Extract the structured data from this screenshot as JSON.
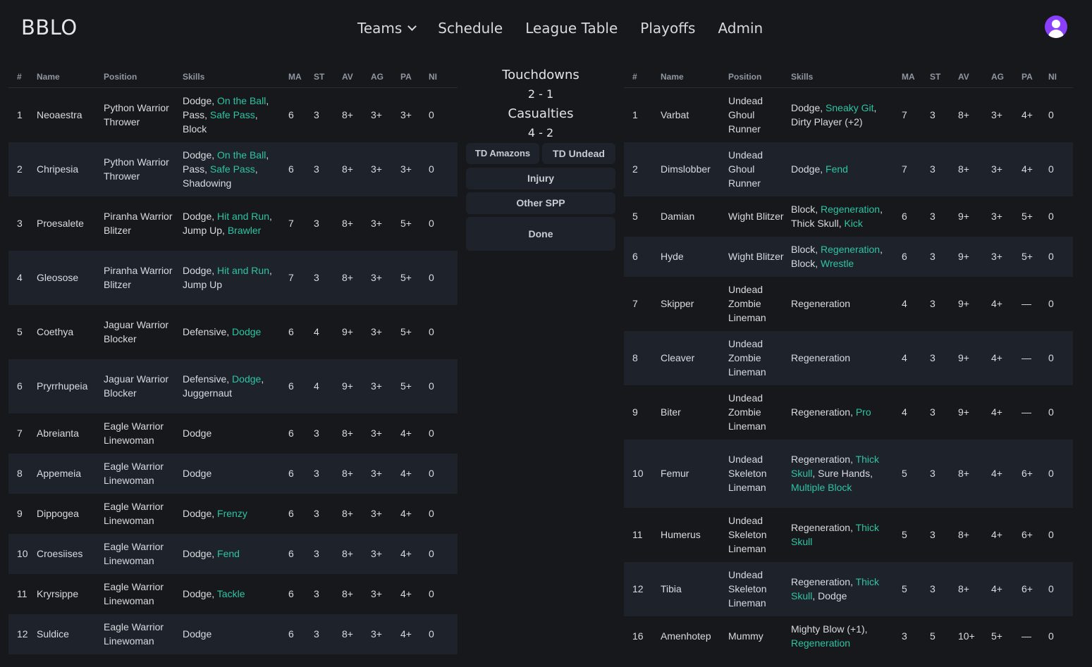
{
  "brand": "BBLO",
  "nav": {
    "teams": "Teams",
    "schedule": "Schedule",
    "league_table": "League Table",
    "playoffs": "Playoffs",
    "admin": "Admin"
  },
  "columns": [
    "#",
    "Name",
    "Position",
    "Skills",
    "MA",
    "ST",
    "AV",
    "AG",
    "PA",
    "NI"
  ],
  "match": {
    "touchdowns_label": "Touchdowns",
    "touchdowns_score": "2 - 1",
    "casualties_label": "Casualties",
    "casualties_score": "4 - 2",
    "buttons": {
      "td_home": "TD Amazons",
      "td_away": "TD Undead",
      "injury": "Injury",
      "other_spp": "Other SPP",
      "done": "Done"
    }
  },
  "home_players": [
    {
      "num": "1",
      "name": "Neoaestra",
      "position": "Python Warrior Thrower",
      "skills": [
        {
          "t": "Dodge",
          "g": false
        },
        {
          "t": "On the Ball",
          "g": true
        },
        {
          "t": "Pass",
          "g": false
        },
        {
          "t": "Safe Pass",
          "g": true
        },
        {
          "t": "Block",
          "g": false
        }
      ],
      "ma": "6",
      "st": "3",
      "av": "8+",
      "ag": "3+",
      "pa": "3+",
      "ni": "0"
    },
    {
      "num": "2",
      "name": "Chripesia",
      "position": "Python Warrior Thrower",
      "skills": [
        {
          "t": "Dodge",
          "g": false
        },
        {
          "t": "On the Ball",
          "g": true
        },
        {
          "t": "Pass",
          "g": false
        },
        {
          "t": "Safe Pass",
          "g": true
        },
        {
          "t": "Shadowing",
          "g": false
        }
      ],
      "ma": "6",
      "st": "3",
      "av": "8+",
      "ag": "3+",
      "pa": "3+",
      "ni": "0"
    },
    {
      "num": "3",
      "name": "Proesalete",
      "position": "Piranha Warrior Blitzer",
      "skills": [
        {
          "t": "Dodge",
          "g": false
        },
        {
          "t": "Hit and Run",
          "g": true
        },
        {
          "t": "Jump Up",
          "g": false
        },
        {
          "t": "Brawler",
          "g": true
        }
      ],
      "ma": "7",
      "st": "3",
      "av": "8+",
      "ag": "3+",
      "pa": "5+",
      "ni": "0"
    },
    {
      "num": "4",
      "name": "Gleosose",
      "position": "Piranha Warrior Blitzer",
      "skills": [
        {
          "t": "Dodge",
          "g": false
        },
        {
          "t": "Hit and Run",
          "g": true
        },
        {
          "t": "Jump Up",
          "g": false
        }
      ],
      "ma": "7",
      "st": "3",
      "av": "8+",
      "ag": "3+",
      "pa": "5+",
      "ni": "0"
    },
    {
      "num": "5",
      "name": "Coethya",
      "position": "Jaguar Warrior Blocker",
      "skills": [
        {
          "t": "Defensive",
          "g": false
        },
        {
          "t": "Dodge",
          "g": true
        }
      ],
      "ma": "6",
      "st": "4",
      "av": "9+",
      "ag": "3+",
      "pa": "5+",
      "ni": "0"
    },
    {
      "num": "6",
      "name": "Pryrrhupeia",
      "position": "Jaguar Warrior Blocker",
      "skills": [
        {
          "t": "Defensive",
          "g": false
        },
        {
          "t": "Dodge",
          "g": true
        },
        {
          "t": "Juggernaut",
          "g": false
        }
      ],
      "ma": "6",
      "st": "4",
      "av": "9+",
      "ag": "3+",
      "pa": "5+",
      "ni": "0"
    },
    {
      "num": "7",
      "name": "Abreianta",
      "position": "Eagle Warrior Linewoman",
      "skills": [
        {
          "t": "Dodge",
          "g": false
        }
      ],
      "ma": "6",
      "st": "3",
      "av": "8+",
      "ag": "3+",
      "pa": "4+",
      "ni": "0"
    },
    {
      "num": "8",
      "name": "Appemeia",
      "position": "Eagle Warrior Linewoman",
      "skills": [
        {
          "t": "Dodge",
          "g": false
        }
      ],
      "ma": "6",
      "st": "3",
      "av": "8+",
      "ag": "3+",
      "pa": "4+",
      "ni": "0"
    },
    {
      "num": "9",
      "name": "Dippogea",
      "position": "Eagle Warrior Linewoman",
      "skills": [
        {
          "t": "Dodge",
          "g": false
        },
        {
          "t": "Frenzy",
          "g": true
        }
      ],
      "ma": "6",
      "st": "3",
      "av": "8+",
      "ag": "3+",
      "pa": "4+",
      "ni": "0"
    },
    {
      "num": "10",
      "name": "Croesiises",
      "position": "Eagle Warrior Linewoman",
      "skills": [
        {
          "t": "Dodge",
          "g": false
        },
        {
          "t": "Fend",
          "g": true
        }
      ],
      "ma": "6",
      "st": "3",
      "av": "8+",
      "ag": "3+",
      "pa": "4+",
      "ni": "0"
    },
    {
      "num": "11",
      "name": "Kryrsippe",
      "position": "Eagle Warrior Linewoman",
      "skills": [
        {
          "t": "Dodge",
          "g": false
        },
        {
          "t": "Tackle",
          "g": true
        }
      ],
      "ma": "6",
      "st": "3",
      "av": "8+",
      "ag": "3+",
      "pa": "4+",
      "ni": "0"
    },
    {
      "num": "12",
      "name": "Suldice",
      "position": "Eagle Warrior Linewoman",
      "skills": [
        {
          "t": "Dodge",
          "g": false
        }
      ],
      "ma": "6",
      "st": "3",
      "av": "8+",
      "ag": "3+",
      "pa": "4+",
      "ni": "0"
    }
  ],
  "away_players": [
    {
      "num": "1",
      "name": "Varbat",
      "position": "Undead Ghoul Runner",
      "skills": [
        {
          "t": "Dodge",
          "g": false
        },
        {
          "t": "Sneaky Git",
          "g": true
        },
        {
          "t": "Dirty Player (+2)",
          "g": false
        }
      ],
      "ma": "7",
      "st": "3",
      "av": "8+",
      "ag": "3+",
      "pa": "4+",
      "ni": "0"
    },
    {
      "num": "2",
      "name": "Dimslobber",
      "position": "Undead Ghoul Runner",
      "skills": [
        {
          "t": "Dodge",
          "g": false
        },
        {
          "t": "Fend",
          "g": true
        }
      ],
      "ma": "7",
      "st": "3",
      "av": "8+",
      "ag": "3+",
      "pa": "4+",
      "ni": "0"
    },
    {
      "num": "5",
      "name": "Damian",
      "position": "Wight Blitzer",
      "skills": [
        {
          "t": "Block",
          "g": false
        },
        {
          "t": "Regeneration",
          "g": true
        },
        {
          "t": "Thick Skull",
          "g": false
        },
        {
          "t": "Kick",
          "g": true
        }
      ],
      "ma": "6",
      "st": "3",
      "av": "9+",
      "ag": "3+",
      "pa": "5+",
      "ni": "0"
    },
    {
      "num": "6",
      "name": "Hyde",
      "position": "Wight Blitzer",
      "skills": [
        {
          "t": "Block",
          "g": false
        },
        {
          "t": "Regeneration",
          "g": true
        },
        {
          "t": "Block",
          "g": false
        },
        {
          "t": "Wrestle",
          "g": true
        }
      ],
      "ma": "6",
      "st": "3",
      "av": "9+",
      "ag": "3+",
      "pa": "5+",
      "ni": "0"
    },
    {
      "num": "7",
      "name": "Skipper",
      "position": "Undead Zombie Lineman",
      "skills": [
        {
          "t": "Regeneration",
          "g": false
        }
      ],
      "ma": "4",
      "st": "3",
      "av": "9+",
      "ag": "4+",
      "pa": "—",
      "ni": "0"
    },
    {
      "num": "8",
      "name": "Cleaver",
      "position": "Undead Zombie Lineman",
      "skills": [
        {
          "t": "Regeneration",
          "g": false
        }
      ],
      "ma": "4",
      "st": "3",
      "av": "9+",
      "ag": "4+",
      "pa": "—",
      "ni": "0"
    },
    {
      "num": "9",
      "name": "Biter",
      "position": "Undead Zombie Lineman",
      "skills": [
        {
          "t": "Regeneration",
          "g": false
        },
        {
          "t": "Pro",
          "g": true
        }
      ],
      "ma": "4",
      "st": "3",
      "av": "9+",
      "ag": "4+",
      "pa": "—",
      "ni": "0"
    },
    {
      "num": "10",
      "name": "Femur",
      "position": "Undead Skeleton Lineman",
      "skills": [
        {
          "t": "Regeneration",
          "g": false
        },
        {
          "t": "Thick Skull",
          "g": true
        },
        {
          "t": "Sure Hands",
          "g": false
        },
        {
          "t": "Multiple Block",
          "g": true
        }
      ],
      "ma": "5",
      "st": "3",
      "av": "8+",
      "ag": "4+",
      "pa": "6+",
      "ni": "0"
    },
    {
      "num": "11",
      "name": "Humerus",
      "position": "Undead Skeleton Lineman",
      "skills": [
        {
          "t": "Regeneration",
          "g": false
        },
        {
          "t": "Thick Skull",
          "g": true
        }
      ],
      "ma": "5",
      "st": "3",
      "av": "8+",
      "ag": "4+",
      "pa": "6+",
      "ni": "0"
    },
    {
      "num": "12",
      "name": "Tibia",
      "position": "Undead Skeleton Lineman",
      "skills": [
        {
          "t": "Regeneration",
          "g": false
        },
        {
          "t": "Thick Skull",
          "g": true
        },
        {
          "t": "Dodge",
          "g": false
        }
      ],
      "ma": "5",
      "st": "3",
      "av": "8+",
      "ag": "4+",
      "pa": "6+",
      "ni": "0"
    },
    {
      "num": "16",
      "name": "Amenhotep",
      "position": "Mummy",
      "skills": [
        {
          "t": "Mighty Blow (+1)",
          "g": false
        },
        {
          "t": "Regeneration",
          "g": true
        }
      ],
      "ma": "3",
      "st": "5",
      "av": "10+",
      "ag": "5+",
      "pa": "—",
      "ni": "0"
    }
  ],
  "colors": {
    "background": "#16181c",
    "row_alt": "#1e232b",
    "skill_highlight": "#2ec4a4",
    "avatar": "#8a3ffc"
  }
}
